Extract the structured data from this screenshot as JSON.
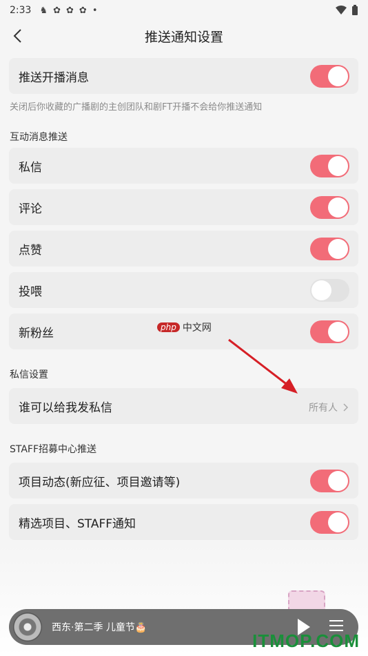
{
  "status": {
    "time": "2:33",
    "icons": [
      "notification-icon",
      "app-icon",
      "app-icon",
      "app-icon",
      "dot-icon"
    ],
    "right_icons": [
      "wifi-icon",
      "battery-icon"
    ]
  },
  "nav": {
    "title": "推送通知设置"
  },
  "push_live": {
    "label": "推送开播消息",
    "on": true
  },
  "hint": "关闭后你收藏的广播剧的主创团队和剧FT开播不会给你推送通知",
  "interaction": {
    "header": "互动消息推送",
    "items": [
      {
        "label": "私信",
        "on": true
      },
      {
        "label": "评论",
        "on": true
      },
      {
        "label": "点赞",
        "on": true
      },
      {
        "label": "投喂",
        "on": false
      },
      {
        "label": "新粉丝",
        "on": true
      }
    ]
  },
  "dm": {
    "header": "私信设置",
    "who_label": "谁可以给我发私信",
    "who_value": "所有人"
  },
  "staff": {
    "header": "STAFF招募中心推送",
    "items": [
      {
        "label": "项目动态(新应征、项目邀请等)",
        "on": true
      },
      {
        "label": "精选项目、STAFF通知",
        "on": true
      }
    ]
  },
  "watermark": {
    "php": "php",
    "cn": "中文网"
  },
  "player": {
    "song": "西东·第二季 儿童节🎂"
  },
  "brand": "ITMOP.COM",
  "colors": {
    "toggle_on": "#f26c78",
    "toggle_off": "#e2e2e2",
    "card": "#ededed",
    "annotation_arrow": "#d61f26"
  }
}
